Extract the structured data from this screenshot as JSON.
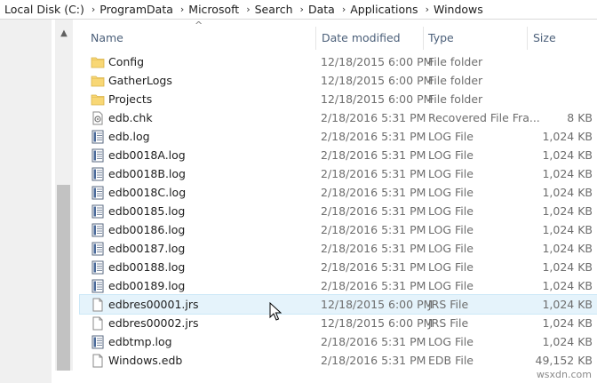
{
  "breadcrumb": {
    "items": [
      "Local Disk (C:)",
      "ProgramData",
      "Microsoft",
      "Search",
      "Data",
      "Applications",
      "Windows"
    ]
  },
  "columns": {
    "name": "Name",
    "date_modified": "Date modified",
    "type": "Type",
    "size": "Size"
  },
  "files": [
    {
      "name": "Config",
      "date": "12/18/2015 6:00 PM",
      "type": "File folder",
      "size": "",
      "icon": "folder-icon"
    },
    {
      "name": "GatherLogs",
      "date": "12/18/2015 6:00 PM",
      "type": "File folder",
      "size": "",
      "icon": "folder-icon"
    },
    {
      "name": "Projects",
      "date": "12/18/2015 6:00 PM",
      "type": "File folder",
      "size": "",
      "icon": "folder-icon"
    },
    {
      "name": "edb.chk",
      "date": "2/18/2016 5:31 PM",
      "type": "Recovered File Fra...",
      "size": "8 KB",
      "icon": "recovered-file-icon"
    },
    {
      "name": "edb.log",
      "date": "2/18/2016 5:31 PM",
      "type": "LOG File",
      "size": "1,024 KB",
      "icon": "log-file-icon"
    },
    {
      "name": "edb0018A.log",
      "date": "2/18/2016 5:31 PM",
      "type": "LOG File",
      "size": "1,024 KB",
      "icon": "log-file-icon"
    },
    {
      "name": "edb0018B.log",
      "date": "2/18/2016 5:31 PM",
      "type": "LOG File",
      "size": "1,024 KB",
      "icon": "log-file-icon"
    },
    {
      "name": "edb0018C.log",
      "date": "2/18/2016 5:31 PM",
      "type": "LOG File",
      "size": "1,024 KB",
      "icon": "log-file-icon"
    },
    {
      "name": "edb00185.log",
      "date": "2/18/2016 5:31 PM",
      "type": "LOG File",
      "size": "1,024 KB",
      "icon": "log-file-icon"
    },
    {
      "name": "edb00186.log",
      "date": "2/18/2016 5:31 PM",
      "type": "LOG File",
      "size": "1,024 KB",
      "icon": "log-file-icon"
    },
    {
      "name": "edb00187.log",
      "date": "2/18/2016 5:31 PM",
      "type": "LOG File",
      "size": "1,024 KB",
      "icon": "log-file-icon"
    },
    {
      "name": "edb00188.log",
      "date": "2/18/2016 5:31 PM",
      "type": "LOG File",
      "size": "1,024 KB",
      "icon": "log-file-icon"
    },
    {
      "name": "edb00189.log",
      "date": "2/18/2016 5:31 PM",
      "type": "LOG File",
      "size": "1,024 KB",
      "icon": "log-file-icon"
    },
    {
      "name": "edbres00001.jrs",
      "date": "12/18/2015 6:00 PM",
      "type": "JRS File",
      "size": "1,024 KB",
      "icon": "blank-file-icon"
    },
    {
      "name": "edbres00002.jrs",
      "date": "12/18/2015 6:00 PM",
      "type": "JRS File",
      "size": "1,024 KB",
      "icon": "blank-file-icon"
    },
    {
      "name": "edbtmp.log",
      "date": "2/18/2016 5:31 PM",
      "type": "LOG File",
      "size": "1,024 KB",
      "icon": "log-file-icon"
    },
    {
      "name": "Windows.edb",
      "date": "2/18/2016 5:31 PM",
      "type": "EDB File",
      "size": "49,152 KB",
      "icon": "blank-file-icon"
    }
  ],
  "hover_row": "edbres00001.jrs",
  "watermark": "wsxdn.com",
  "colors": {
    "header_text": "#4c607a",
    "detail_text": "#6d6d6d",
    "hover_row": "#e5f3fb",
    "folder_yellow": "#f8d775"
  }
}
